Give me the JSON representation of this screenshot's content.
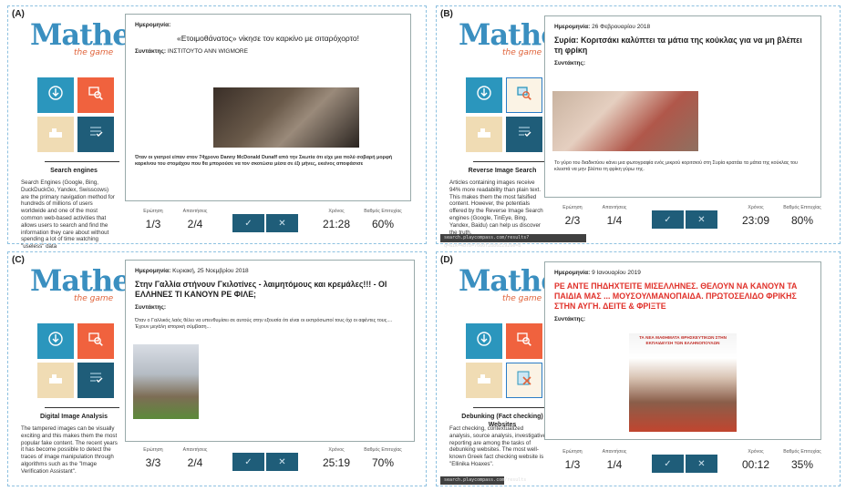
{
  "stats_labels": {
    "question": "Ερώτηση",
    "answers": "Απαντήσεις",
    "time": "Χρόνος",
    "score": "Βαθμός Επιτυχίας"
  },
  "panels": [
    {
      "letter": "(A)",
      "tool_title": "Search engines",
      "tool_desc": "Search Engines (Google, Bing, DuckDuckGo, Yandex, Swisscows) are the primary navigation method for hundreds of millions of users worldwide and one of the most common web-based activities that allows users to search and find the information they care about without spending a lot of time watching \"useless\" data",
      "date_label": "Ημερομηνία:",
      "date_value": "",
      "title": "«Ετοιμοθάνατος» νίκησε τον καρκίνο με σιταρόχορτο!",
      "author_label": "Συντάκτης:",
      "author_value": "ΙΝΣΤΙΤΟΥΤΟ ANN WIGMORE",
      "body": "Όταν οι γιατροί είπαν στον 74χρονο Danny McDonald Dunaff από την Σκωτία ότι είχε μια πολύ σοβαρή μορφή καρκίνου του στομάχου που θα μπορούσε να τον σκοτώσει μέσα σε έξι μήνες, εκείνος αποφάσισε",
      "question": "1/3",
      "answers": "2/4",
      "time": "21:28",
      "score": "60%",
      "url": ""
    },
    {
      "letter": "(B)",
      "tool_title": "Reverse Image Search",
      "tool_desc": "Articles containing images receive 94% more readability than plain text. This makes them the most falsified content. However, the potentials offered by the Reverse Image Search engines (Google, TinEye, Bing, Yandex, Baidu) can help us discover the truth.",
      "date_label": "Ημερομηνία:",
      "date_value": "26 Φεβρουαρίου 2018",
      "title": "Συρία: Κοριτσάκι καλύπτει τα μάτια της κούκλας για να μη βλέπει τη φρίκη",
      "author_label": "Συντάκτης:",
      "author_value": "",
      "body": "Το γύρο του διαδικτύου κάνει μια φωτογραφία ενός μικρού κοριτσιού στη Συρία κρατάει τα μάτια της κούκλας του κλειστά να μην βλέπει τη φρίκη γύρω της.",
      "question": "2/3",
      "answers": "1/4",
      "time": "23:09",
      "score": "80%",
      "url": "search.playcompass.com/results?q=&ik=4bfb=7660f2886E2926e=8"
    },
    {
      "letter": "(C)",
      "tool_title": "Digital Image Analysis",
      "tool_desc": "The tampered images can be visually exciting and this makes them the most popular fake content. The recent years it has become possible to detect the traces of image manipulation through algorithms such as the \"Image Verification Assistant\".",
      "date_label": "Ημερομηνία:",
      "date_value": "Κυριακή, 25 Νοεμβρίου 2018",
      "title": "Στην Γαλλία στήνουν Γκιλοτίνες - λαιμητόμους και κρεμάλες!!! - ΟΙ ΕΛΛΗΝΕΣ ΤΙ ΚΑΝΟΥΝ ΡΕ ΦΙΛΕ;",
      "author_label": "Συντάκτης:",
      "author_value": "",
      "body": "Όταν ο Γαλλικός λαός θέλει να υπενθυμίσει σε αυτούς στην εξουσία ότι είναι οι εκπρόσωποί τους όχι οι αφέντες τους.... Έχουν μεγάλη ιστορική σύμβαση...",
      "question": "3/3",
      "answers": "2/4",
      "time": "25:19",
      "score": "70%",
      "url": ""
    },
    {
      "letter": "(D)",
      "tool_title": "Debunking (Fact checking) Websites",
      "tool_desc": "Fact checking, contextualized analysis, source analysis, investigative reporting are among the tasks of debunking websites. The most well-known Greek fact checking website is \"Ellinika Hoaxes\".",
      "date_label": "Ημερομηνία:",
      "date_value": "9 Ιανουαρίου 2019",
      "title": "ΡΕ ΑΝΤΕ ΠΗΔΗΧΤΕΙΤΕ ΜΙΣΕΛΛΗΝΕΣ. ΘΕΛΟΥΝ ΝΑ ΚΑΝΟΥΝ ΤΑ ΠΑΙΔΙΑ ΜΑΣ ... ΜΟΥΣΟΥΛΜΑΝΟΠΑΙΔΑ. ΠΡΩΤΟΣΕΛΙΔΟ ΦΡΙΚΗΣ ΣΤΗΝ ΑΥΓΗ. ΔΕΙΤΕ & ΦΡΙΞΤΕ",
      "author_label": "Συντάκτης:",
      "author_value": "",
      "body": "",
      "image_caption": "ΤΑ ΝΕΑ ΜΑΘΗΜΑΤΑ ΘΡΗΣΚΕΥΤΙΚΩΝ ΣΤΗΝ ΕΚΠΑΙΔΕΥΣΗ ΤΩΝ ΕΛΛΗΝΟΠΟΥΛΩΝ",
      "question": "1/3",
      "answers": "1/4",
      "time": "00:12",
      "score": "35%",
      "url": "search.playcompass.com/results"
    }
  ],
  "logo": {
    "main": "Mathe",
    "sub": "the game"
  },
  "buttons": {
    "check": "✓",
    "cross": "✕"
  },
  "colors": {
    "tile_blue": "#2b96bd",
    "tile_orange": "#f0623e",
    "tile_beige": "#f0dcb4",
    "tile_navy": "#1f5d79",
    "red_title": "#e0312a"
  }
}
